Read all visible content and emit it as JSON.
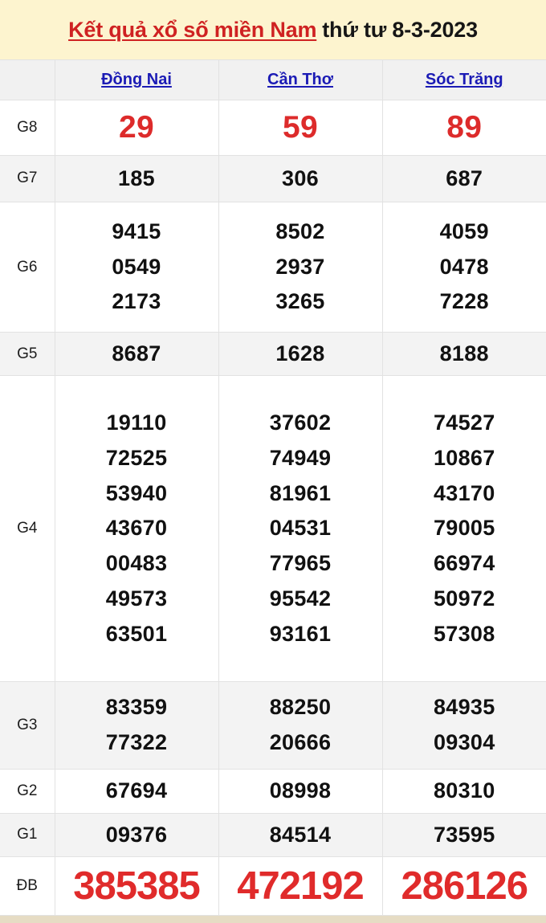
{
  "header": {
    "title_main": "Kết quả xổ số miền Nam",
    "title_date": "thứ tư 8-3-2023",
    "background_color": "#fdf4cf",
    "title_color": "#cf2222",
    "date_color": "#161616"
  },
  "table": {
    "corner_label": "",
    "provinces": [
      {
        "name": "Đồng Nai"
      },
      {
        "name": "Cần Thơ"
      },
      {
        "name": "Sóc Trăng"
      }
    ],
    "province_color": "#1b1bb5",
    "highlight_color": "#dd2b2b",
    "rows": [
      {
        "label": "G8",
        "values": [
          [
            "29"
          ],
          [
            "59"
          ],
          [
            "89"
          ]
        ]
      },
      {
        "label": "G7",
        "values": [
          [
            "185"
          ],
          [
            "306"
          ],
          [
            "687"
          ]
        ]
      },
      {
        "label": "G6",
        "values": [
          [
            "9415",
            "0549",
            "2173"
          ],
          [
            "8502",
            "2937",
            "3265"
          ],
          [
            "4059",
            "0478",
            "7228"
          ]
        ]
      },
      {
        "label": "G5",
        "values": [
          [
            "8687"
          ],
          [
            "1628"
          ],
          [
            "8188"
          ]
        ]
      },
      {
        "label": "G4",
        "values": [
          [
            "19110",
            "72525",
            "53940",
            "43670",
            "00483",
            "49573",
            "63501"
          ],
          [
            "37602",
            "74949",
            "81961",
            "04531",
            "77965",
            "95542",
            "93161"
          ],
          [
            "74527",
            "10867",
            "43170",
            "79005",
            "66974",
            "50972",
            "57308"
          ]
        ]
      },
      {
        "label": "G3",
        "values": [
          [
            "83359",
            "77322"
          ],
          [
            "88250",
            "20666"
          ],
          [
            "84935",
            "09304"
          ]
        ]
      },
      {
        "label": "G2",
        "values": [
          [
            "67694"
          ],
          [
            "08998"
          ],
          [
            "80310"
          ]
        ]
      },
      {
        "label": "G1",
        "values": [
          [
            "09376"
          ],
          [
            "84514"
          ],
          [
            "73595"
          ]
        ]
      },
      {
        "label": "ĐB",
        "values": [
          [
            "385385"
          ],
          [
            "472192"
          ],
          [
            "286126"
          ]
        ]
      }
    ]
  }
}
